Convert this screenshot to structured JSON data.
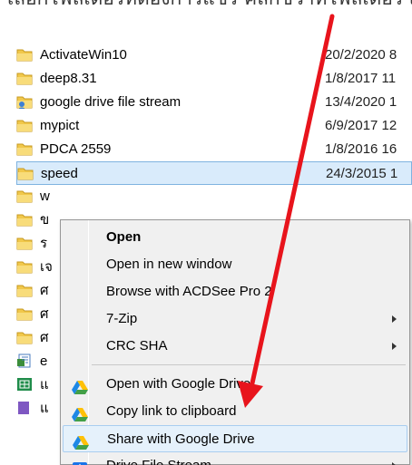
{
  "caption": "เลือกโฟลเดอร์ที่ต้องการแชร์ คลิกขวาที่โฟลเดอร์ และเลือก Share with G",
  "files": [
    {
      "name": "ActivateWin10",
      "date": "20/2/2020 8",
      "icon": "folder-icon"
    },
    {
      "name": "deep8.31",
      "date": "1/8/2017 11",
      "icon": "folder-icon"
    },
    {
      "name": "google drive file stream",
      "date": "13/4/2020 1",
      "icon": "shared-folder-icon"
    },
    {
      "name": "mypict",
      "date": "6/9/2017 12",
      "icon": "folder-icon"
    },
    {
      "name": "PDCA 2559",
      "date": "1/8/2016 16",
      "icon": "folder-icon"
    },
    {
      "name": "speed",
      "date": "24/3/2015 1",
      "icon": "folder-icon"
    },
    {
      "name": "w",
      "date": "",
      "icon": "folder-icon"
    },
    {
      "name": "ข",
      "date": "",
      "icon": "folder-icon"
    },
    {
      "name": "ร",
      "date": "",
      "icon": "folder-icon"
    },
    {
      "name": "เจ",
      "date": "",
      "icon": "folder-icon"
    },
    {
      "name": "ศ",
      "date": "",
      "icon": "folder-icon"
    },
    {
      "name": "ศ",
      "date": "",
      "icon": "folder-icon"
    },
    {
      "name": "ศ",
      "date": "",
      "icon": "folder-icon"
    },
    {
      "name": "e",
      "date": "",
      "icon": "document-icon"
    },
    {
      "name": "แ",
      "date": "",
      "icon": "spreadsheet-icon"
    },
    {
      "name": "แ",
      "date": "",
      "icon": "file-icon"
    }
  ],
  "menu": {
    "open": "Open",
    "open_new_window": "Open in new window",
    "browse_acdsee": "Browse with ACDSee Pro 2",
    "seven_zip": "7-Zip",
    "crc_sha": "CRC SHA",
    "open_google_drive": "Open with Google Drive",
    "copy_link": "Copy link to clipboard",
    "share_google_drive": "Share with Google Drive",
    "drive_file_stream": "Drive File Stream"
  },
  "colors": {
    "annotation_arrow": "#e8141c",
    "selection": "#d9ebfb",
    "menu_bg": "#f0f0f0"
  }
}
